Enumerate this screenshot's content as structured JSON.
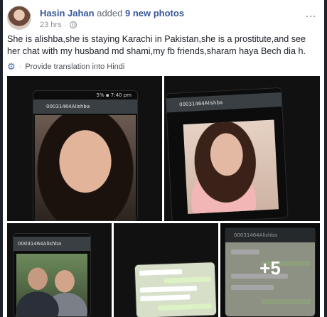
{
  "post": {
    "author": "Hasin Jahan",
    "action": "added",
    "photo_count_label": "9 new photos",
    "time": "23 hrs",
    "text": "She is alishba,she is staying Karachi in Pakistan,she is a prostitute,and see her chat with my husband md shami,my fb friends,sharam haya Bech dia h.",
    "translate_label": "Provide translation into Hindi"
  },
  "photos": [
    {
      "chat_name": "00031464Alishba",
      "status": "5% ▪ 7:40 pm"
    },
    {
      "chat_name": "00031464Alishba",
      "status": ""
    },
    {
      "chat_name": "00031464Alishba",
      "status": ""
    },
    {
      "chat_name": "",
      "status": ""
    },
    {
      "chat_name": "00031464Alishba",
      "status": "",
      "more_overlay": "+5"
    }
  ],
  "icons": {
    "globe": "globe-icon",
    "gear": "gear-icon",
    "more": "more-options-icon"
  },
  "colors": {
    "link": "#365899",
    "meta": "#90949c",
    "text": "#1d2129"
  }
}
